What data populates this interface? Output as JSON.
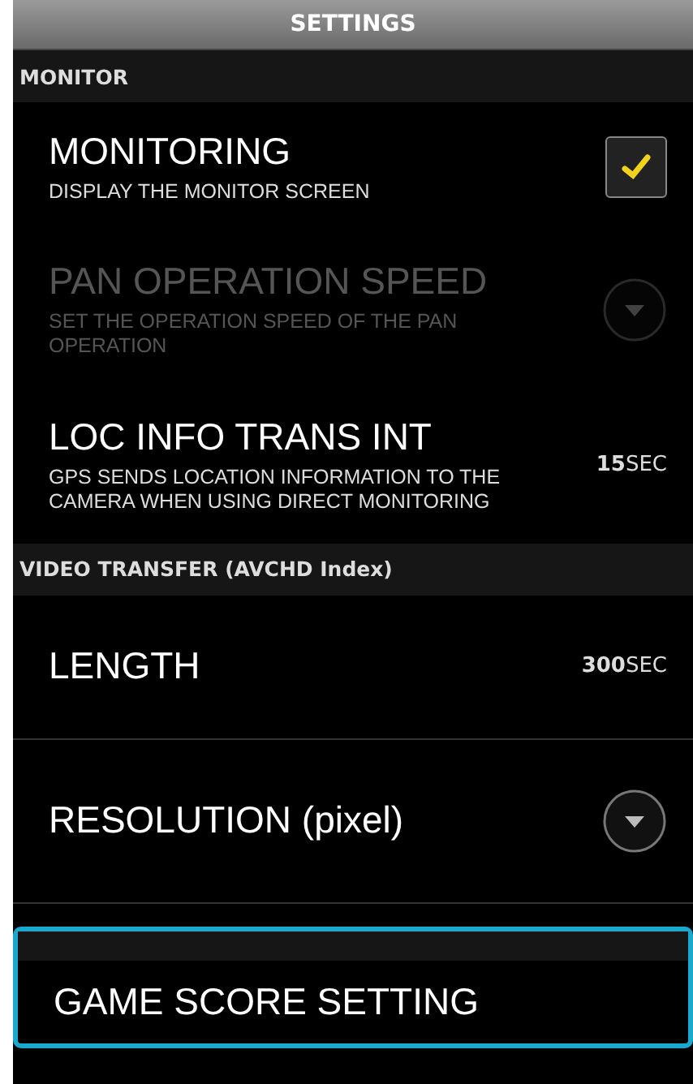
{
  "title_bar": {
    "title": "SETTINGS"
  },
  "sections": [
    {
      "header": "MONITOR",
      "highlighted": false,
      "items": [
        {
          "kind": "checkbox",
          "title": "MONITORING",
          "description": "DISPLAY THE MONITOR SCREEN",
          "checked": true,
          "disabled": false
        },
        {
          "kind": "dropdown",
          "title": "PAN OPERATION SPEED",
          "description": "SET THE OPERATION SPEED OF THE PAN OPERATION",
          "disabled": true
        },
        {
          "kind": "value",
          "title": "LOC INFO TRANS INT",
          "description": "GPS SENDS LOCATION INFORMATION TO THE CAMERA WHEN USING DIRECT MONITORING",
          "value": "**15**SEC",
          "disabled": false
        }
      ]
    },
    {
      "header": "VIDEO TRANSFER (AVCHD Index)",
      "highlighted": false,
      "items": [
        {
          "kind": "value",
          "title": "LENGTH",
          "value": "**300**SEC",
          "disabled": false
        },
        {
          "kind": "dropdown",
          "title": "RESOLUTION (pixel)",
          "disabled": false
        }
      ]
    },
    {
      "highlighted": true,
      "items": [
        {
          "kind": "plain",
          "title": "GAME SCORE SETTING",
          "disabled": false
        }
      ]
    }
  ]
}
